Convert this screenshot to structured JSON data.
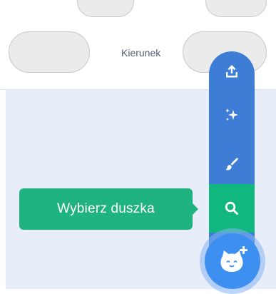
{
  "properties": {
    "direction_label": "Kierunek"
  },
  "sprite_menu": {
    "tooltip_text": "Wybierz duszka",
    "items": [
      {
        "name": "upload-sprite",
        "icon": "upload-icon"
      },
      {
        "name": "surprise",
        "icon": "sparkles-icon"
      },
      {
        "name": "paint",
        "icon": "paintbrush-icon"
      },
      {
        "name": "choose-sprite",
        "icon": "search-icon"
      }
    ],
    "main_button_icon": "cat-plus-icon"
  },
  "colors": {
    "menu_blue": "#3d7dd6",
    "highlight_green": "#11b77f",
    "tooltip_green": "#1fb47f",
    "fab_blue": "#3d8ff0",
    "stage_bg": "#e8eef9",
    "label_gray": "#575e75"
  }
}
